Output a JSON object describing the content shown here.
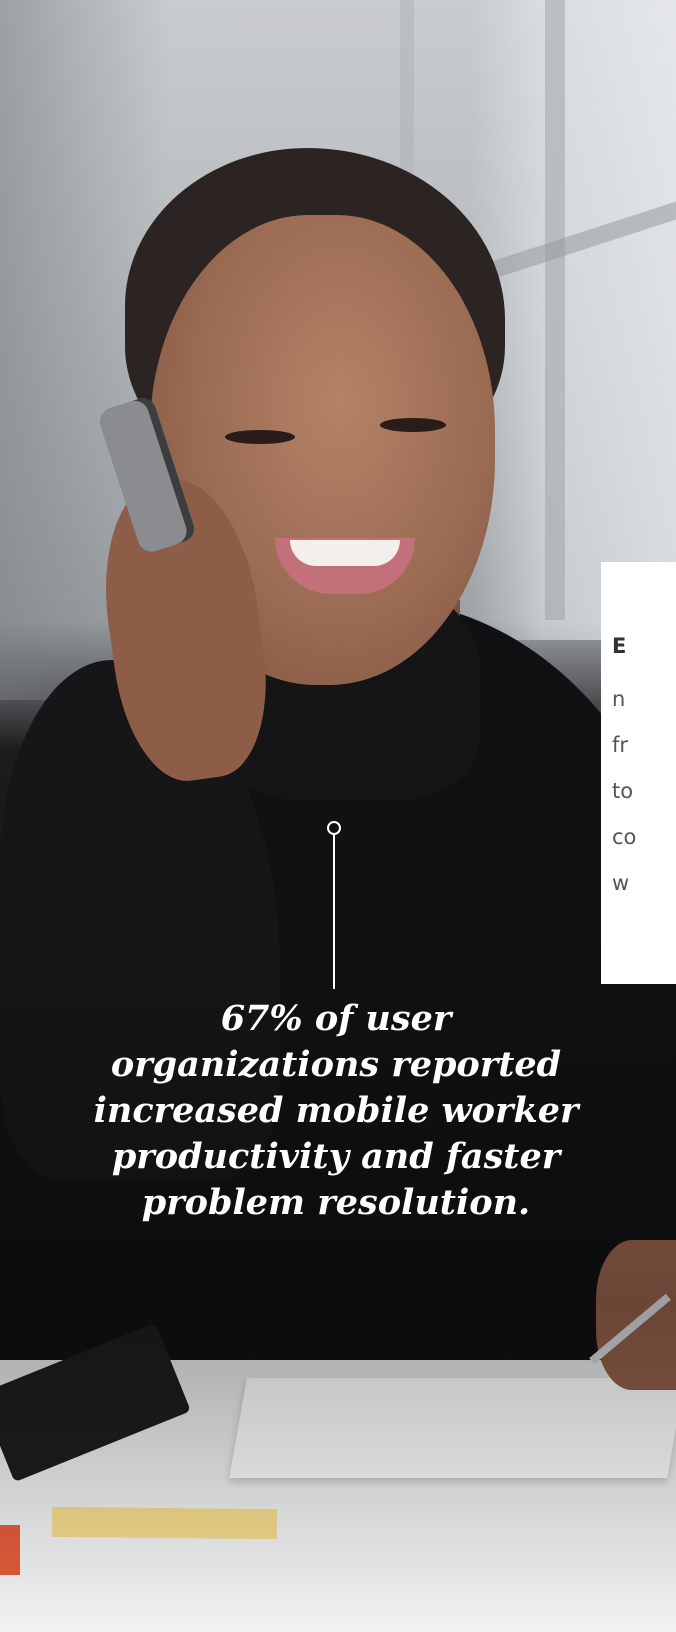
{
  "hero": {
    "image_alt": "Woman smiling while talking on a mobile phone at a desk"
  },
  "stat_callout": {
    "text": "67% of user organizations reported increased mobile worker productivity and faster problem resolution."
  },
  "side_card": {
    "heading": "E",
    "lines": [
      "n",
      "fr",
      "to",
      "co",
      "w"
    ]
  },
  "colors": {
    "callout_text": "#ffffff",
    "card_background": "#ffffff",
    "card_text": "#555555"
  }
}
